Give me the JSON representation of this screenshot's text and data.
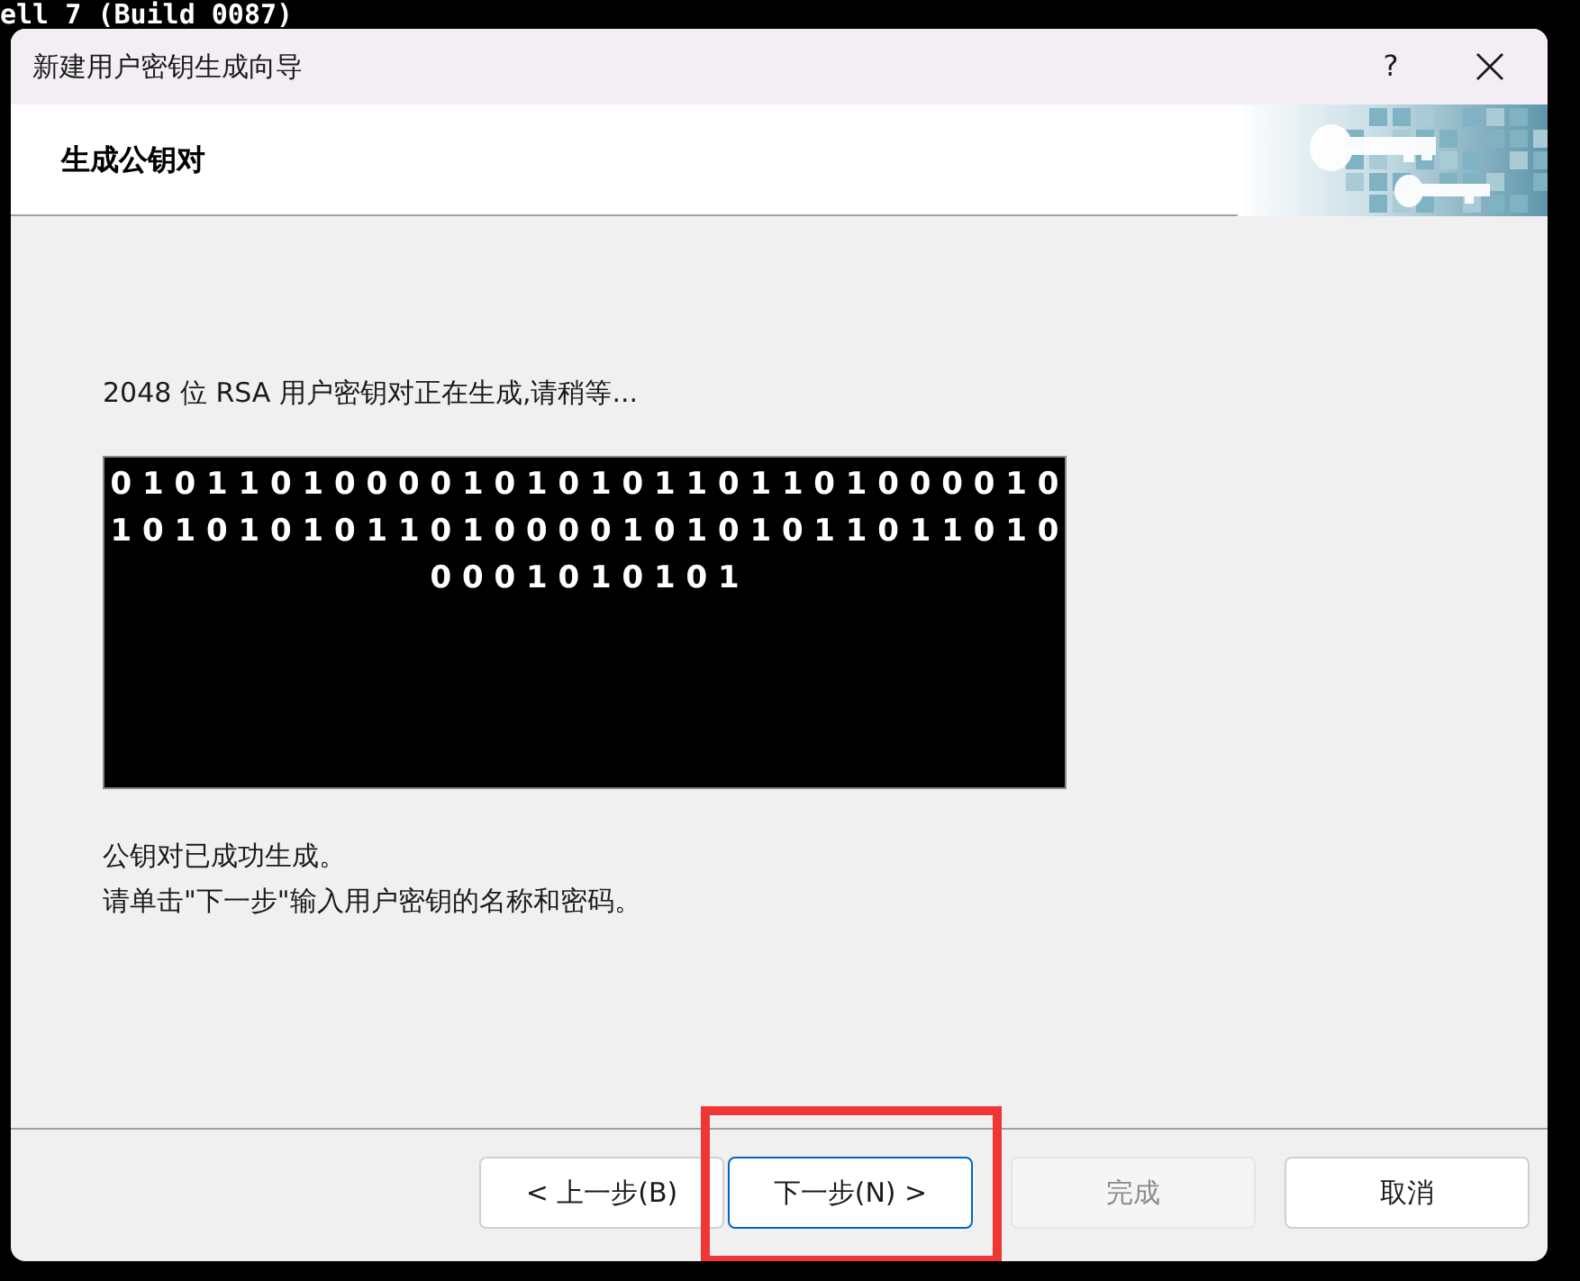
{
  "terminal": {
    "title_fragment": "ell 7 (Build 0087)"
  },
  "dialog": {
    "title": "新建用户密钥生成向导",
    "help": "?",
    "header": {
      "title": "生成公钥对"
    },
    "status": "2048 位 RSA 用户密钥对正在生成,请稍等...",
    "binary_lines": [
      "0 1 0 1 1 0 1 0 0 0 0 1 0 1 0 1 0 1 1 0 1 1 0 1 0 0 0 0 1 0",
      "1 0 1 0 1 0 1 0 1 1 0 1 0 0 0 0 1 0 1 0 1 0 1 1 0 1 1 0 1 0",
      "0 0 0 1 0 1 0 1 0 1"
    ],
    "messages": [
      "公钥对已成功生成。",
      "请单击\"下一步\"输入用户密钥的名称和密码。"
    ],
    "buttons": [
      {
        "label": "< 上一步(B)",
        "disabled": false,
        "focused": false,
        "highlighted": false
      },
      {
        "label": "下一步(N) >",
        "disabled": false,
        "focused": true,
        "highlighted": true
      },
      {
        "label": "完成",
        "disabled": true,
        "focused": false,
        "highlighted": false
      },
      {
        "label": "取消",
        "disabled": false,
        "focused": false,
        "highlighted": false
      }
    ]
  }
}
